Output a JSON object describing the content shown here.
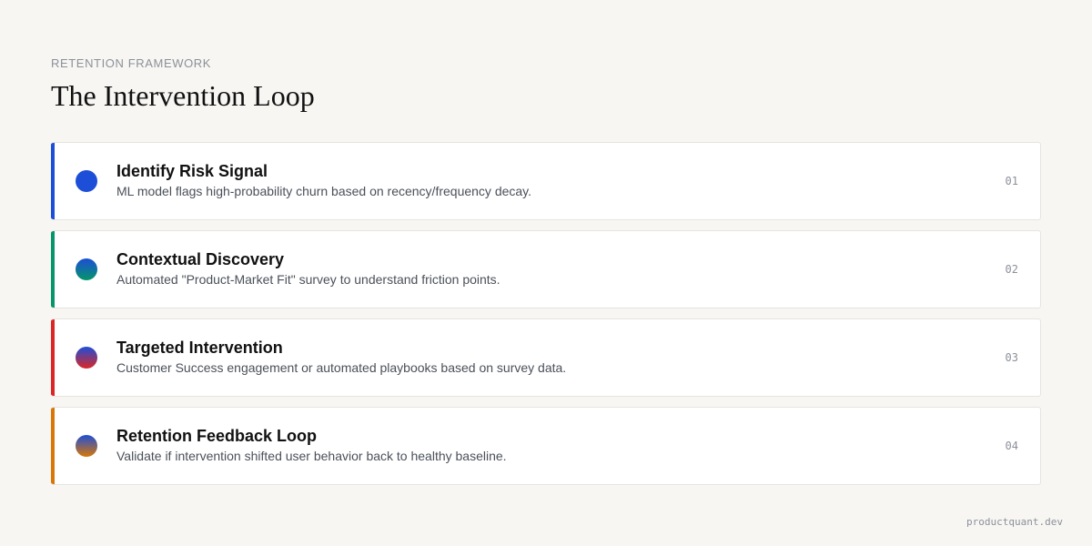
{
  "header": {
    "kicker": "RETENTION FRAMEWORK",
    "title": "The Intervention Loop"
  },
  "steps": [
    {
      "title": "Identify Risk Signal",
      "description": "ML model flags high-probability churn based on recency/frequency decay.",
      "number": "01",
      "accent": "#1d4ed8",
      "dot_colors": [
        "#1d4ed8",
        "#1d4ed8"
      ]
    },
    {
      "title": "Contextual Discovery",
      "description": "Automated \"Product-Market Fit\" survey to understand friction points.",
      "number": "02",
      "accent": "#059669",
      "dot_colors": [
        "#1d4ed8",
        "#059669"
      ]
    },
    {
      "title": "Targeted Intervention",
      "description": "Customer Success engagement or automated playbooks based on survey data.",
      "number": "03",
      "accent": "#dc2626",
      "dot_colors": [
        "#1d4ed8",
        "#dc2626"
      ]
    },
    {
      "title": "Retention Feedback Loop",
      "description": "Validate if intervention shifted user behavior back to healthy baseline.",
      "number": "04",
      "accent": "#d97706",
      "dot_colors": [
        "#1d4ed8",
        "#d97706"
      ]
    }
  ],
  "footer": {
    "text": "productquant.dev"
  }
}
